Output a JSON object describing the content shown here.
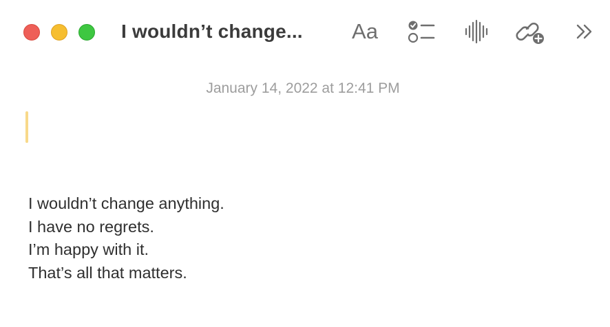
{
  "window": {
    "title": "I wouldn’t change..."
  },
  "toolbar": {
    "format_label": "Aa",
    "buttons": [
      {
        "icon": "format-text-icon",
        "label": "Aa"
      },
      {
        "icon": "checklist-icon"
      },
      {
        "icon": "audio-waveform-icon"
      },
      {
        "icon": "collaborate-link-icon"
      },
      {
        "icon": "chevron-double-right-icon"
      }
    ]
  },
  "note": {
    "date": "January 14, 2022 at 12:41 PM",
    "lines": [
      "I wouldn’t change anything.",
      "I have no regrets.",
      "I’m happy with it.",
      "That’s all that matters."
    ]
  },
  "colors": {
    "close": "#ee5f58",
    "minimize": "#f6be30",
    "zoom": "#3ec741",
    "caret": "#f8d98a",
    "date_text": "#9d9d9d",
    "body_text": "#2f2f2f"
  }
}
